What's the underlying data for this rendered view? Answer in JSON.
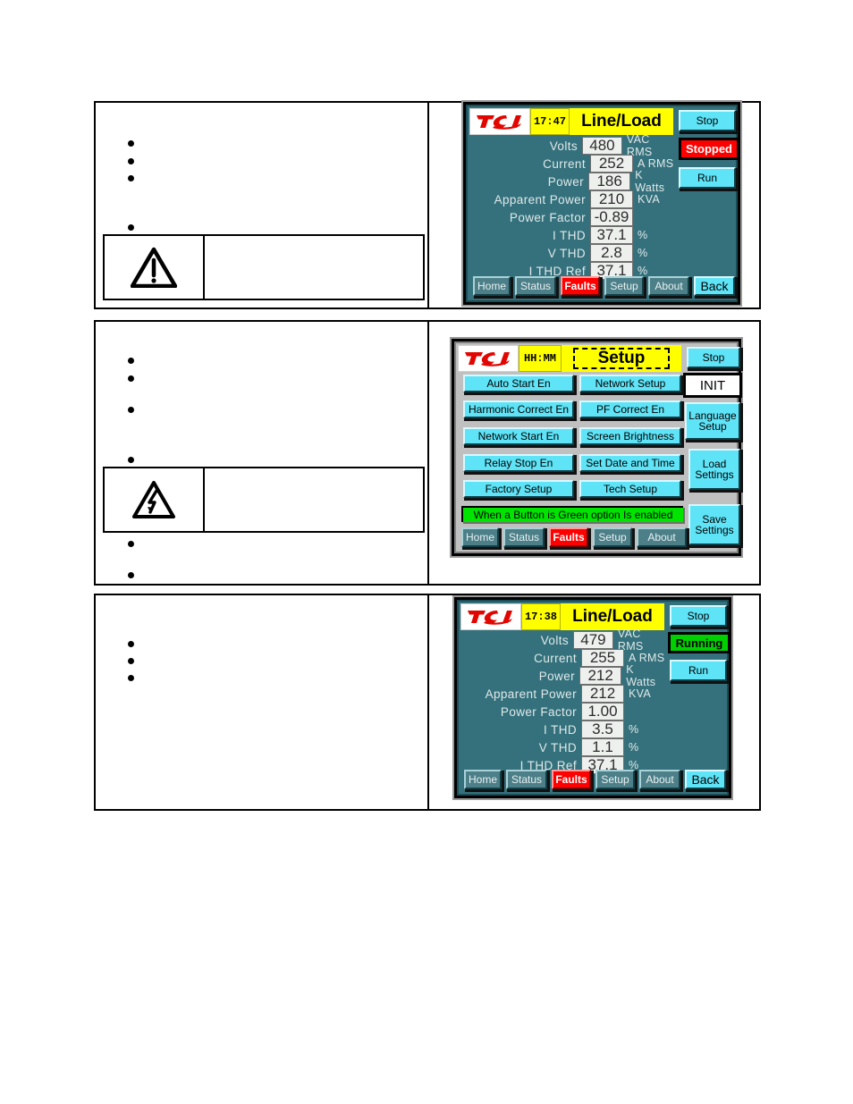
{
  "document": {
    "warning_rows": [
      {
        "icon": "warning-exclamation-triangle-icon",
        "bullets": 4
      },
      {
        "icon": "electrical-hazard-lightning-triangle-icon",
        "bullets": 6
      },
      {
        "icon": "",
        "bullets": 3
      }
    ]
  },
  "panel1": {
    "name": "line-load-stopped",
    "logo": "tci-logo",
    "clock": "17:47",
    "title": "Line/Load",
    "stop_label": "Stop",
    "run_label": "Run",
    "status": "Stopped",
    "status_color": "#ff0000",
    "readouts": [
      {
        "label": "Volts",
        "value": "480",
        "unit": "VAC RMS"
      },
      {
        "label": "Current",
        "value": "252",
        "unit": "A RMS"
      },
      {
        "label": "Power",
        "value": "186",
        "unit": "K Watts"
      },
      {
        "label": "Apparent Power",
        "value": "210",
        "unit": "KVA"
      },
      {
        "label": "Power Factor",
        "value": "-0.89",
        "unit": ""
      },
      {
        "label": "I THD",
        "value": "37.1",
        "unit": "%"
      },
      {
        "label": "V THD",
        "value": "2.8",
        "unit": "%"
      },
      {
        "label": "I THD Ref",
        "value": "37.1",
        "unit": "%"
      }
    ],
    "nav": [
      {
        "label": "Home",
        "style": "gray"
      },
      {
        "label": "Status",
        "style": "gray"
      },
      {
        "label": "Faults",
        "style": "red"
      },
      {
        "label": "Setup",
        "style": "gray"
      },
      {
        "label": "About",
        "style": "gray"
      },
      {
        "label": "Back",
        "style": "cyan"
      }
    ]
  },
  "panel2": {
    "name": "setup-screen",
    "logo": "tci-logo",
    "clock": "HH:MM",
    "title": "Setup",
    "stop_label": "Stop",
    "status": "INIT",
    "buttons_left": [
      "Auto Start En",
      "Harmonic Correct En",
      "Network Start En",
      "Relay Stop En",
      "Factory Setup"
    ],
    "buttons_middle": [
      "Network Setup",
      "PF Correct En",
      "Screen Brightness",
      "Set Date and Time",
      "Tech Setup"
    ],
    "buttons_right": [
      "Language Setup",
      "Load Settings",
      "Save Settings"
    ],
    "hint": "When a Button is Green option Is enabled",
    "hint_color": "#00e400",
    "nav": [
      {
        "label": "Home",
        "style": "gray"
      },
      {
        "label": "Status",
        "style": "gray"
      },
      {
        "label": "Faults",
        "style": "red"
      },
      {
        "label": "Setup",
        "style": "gray"
      },
      {
        "label": "About",
        "style": "gray"
      }
    ]
  },
  "panel3": {
    "name": "line-load-running",
    "logo": "tci-logo",
    "clock": "17:38",
    "title": "Line/Load",
    "stop_label": "Stop",
    "run_label": "Run",
    "status": "Running",
    "status_color": "#00d000",
    "readouts": [
      {
        "label": "Volts",
        "value": "479",
        "unit": "VAC RMS"
      },
      {
        "label": "Current",
        "value": "255",
        "unit": "A RMS"
      },
      {
        "label": "Power",
        "value": "212",
        "unit": "K Watts"
      },
      {
        "label": "Apparent Power",
        "value": "212",
        "unit": "KVA"
      },
      {
        "label": "Power Factor",
        "value": "1.00",
        "unit": ""
      },
      {
        "label": "I THD",
        "value": "3.5",
        "unit": "%"
      },
      {
        "label": "V THD",
        "value": "1.1",
        "unit": "%"
      },
      {
        "label": "I THD Ref",
        "value": "37.1",
        "unit": "%"
      }
    ],
    "nav": [
      {
        "label": "Home",
        "style": "gray"
      },
      {
        "label": "Status",
        "style": "gray"
      },
      {
        "label": "Faults",
        "style": "red"
      },
      {
        "label": "Setup",
        "style": "gray"
      },
      {
        "label": "About",
        "style": "gray"
      },
      {
        "label": "Back",
        "style": "cyan"
      }
    ]
  }
}
